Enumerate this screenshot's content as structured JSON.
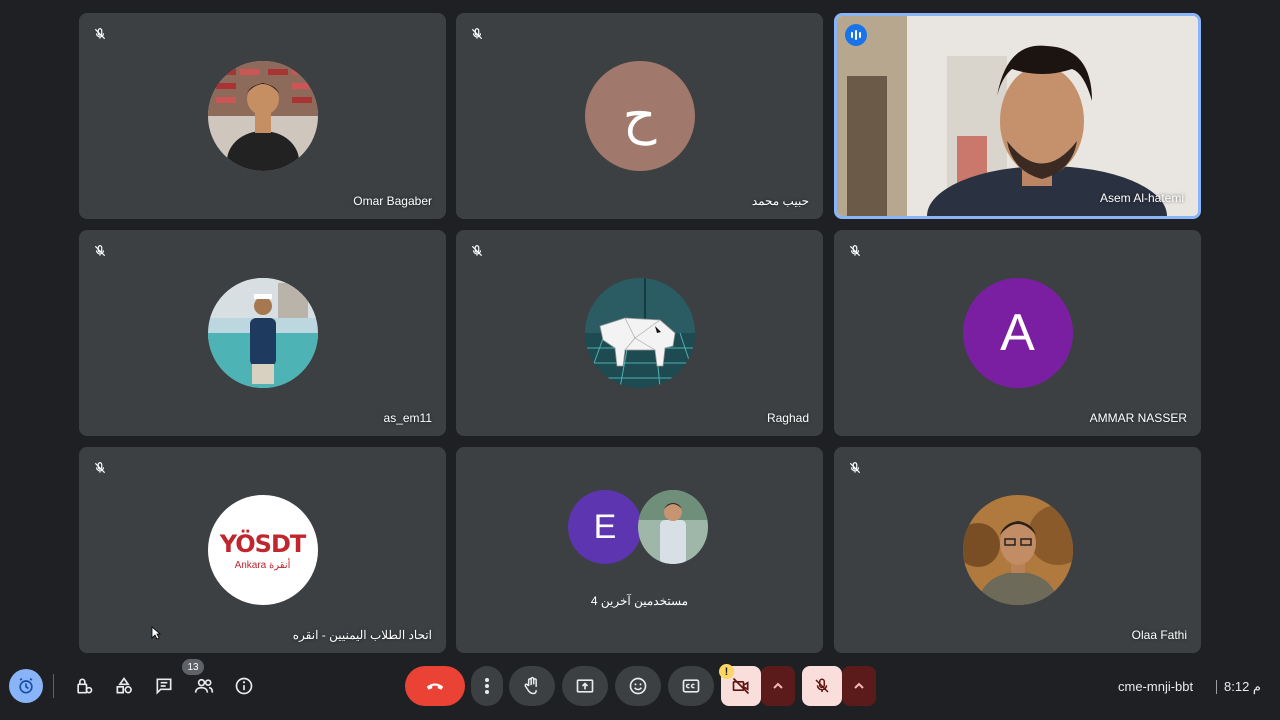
{
  "participants": [
    {
      "name": "Omar Bagaber",
      "mic": "muted"
    },
    {
      "name": "حبيب محمد",
      "mic": "muted",
      "initial": "ح",
      "color": "#a1786c"
    },
    {
      "name": "Asem Al-hatemi",
      "mic": "speaking"
    },
    {
      "name": "as_em11",
      "mic": "muted"
    },
    {
      "name": "Raghad",
      "mic": "muted"
    },
    {
      "name": "AMMAR NASSER",
      "mic": "muted",
      "initial": "A",
      "color": "#7b1fa2"
    },
    {
      "name": "اتحاد الطلاب اليمنيين - انقره",
      "mic": "muted",
      "logo_text": "YÖSDT",
      "logo_sub": "Ankara أنقرة"
    },
    {
      "name": "4 مستخدمين آخرين",
      "group_initial": "E",
      "group_color": "#5e35b1"
    },
    {
      "name": "Olaa Fathi",
      "mic": "muted"
    }
  ],
  "toolbar": {
    "people_badge": "13",
    "meeting_code": "cme-mnji-bbt",
    "time": "8:12 م",
    "leave_color": "#ea4335",
    "warning_badge": "!"
  },
  "icons": {
    "left": [
      "timer-icon",
      "host-controls-icon",
      "activities-icon",
      "chat-icon",
      "people-icon",
      "info-icon"
    ],
    "center": [
      "end-call-icon",
      "more-options-icon",
      "raise-hand-icon",
      "present-icon",
      "emoji-icon",
      "captions-icon",
      "camera-off-icon",
      "mic-off-icon"
    ]
  }
}
